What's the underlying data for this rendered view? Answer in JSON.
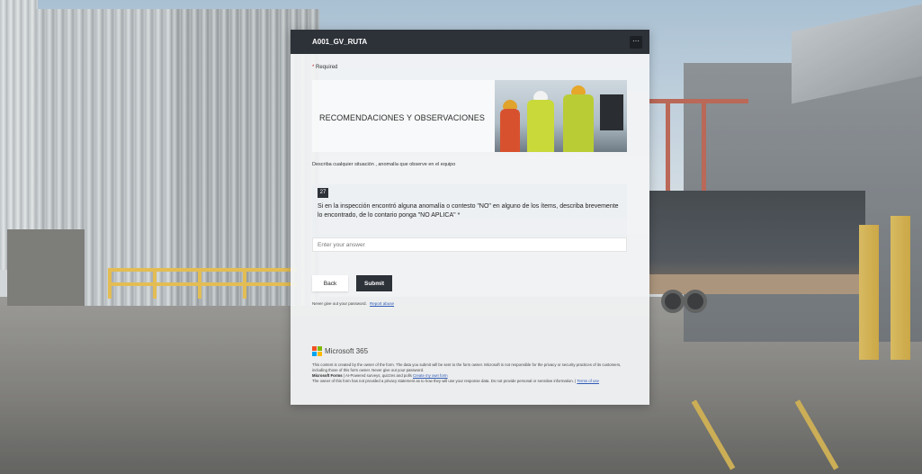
{
  "form": {
    "title": "A001_GV_RUTA",
    "more_icon": "ellipsis-icon",
    "more_label": "···",
    "required_star": "*",
    "required_label": "Required"
  },
  "section": {
    "title": "RECOMENDACIONES Y OBSERVACIONES",
    "description": "Describa cualquier situación , anomalía que observe en el equipo"
  },
  "question": {
    "number": "27",
    "text": "Si en la inspección encontró alguna anomalía o contesto \"NO\" en alguno de los ítems, describa brevemente lo encontrado, de lo contario ponga \"NO APLICA\" *",
    "placeholder": "Enter your answer"
  },
  "actions": {
    "back_label": "Back",
    "submit_label": "Submit"
  },
  "password_note": {
    "text": "Never give out your password.",
    "report_link": "Report abuse"
  },
  "footer": {
    "brand": "Microsoft 365",
    "brand_colors": [
      "#f25022",
      "#7fba00",
      "#00a4ef",
      "#ffb900"
    ],
    "disclaimer": "This content is created by the owner of the form. The data you submit will be sent to the form owner. Microsoft is not responsible for the privacy or security practices of its customers, including those of this form owner. Never give out your password.",
    "forms_label": "Microsoft Forms",
    "forms_tagline": "| AI-Powered surveys, quizzes and polls",
    "create_link": "Create my own form",
    "privacy_text": "The owner of this form has not provided a privacy statement as to how they will use your response data. Do not provide personal or sensitive information.",
    "terms_separator": "|",
    "terms_link": "Terms of use"
  }
}
